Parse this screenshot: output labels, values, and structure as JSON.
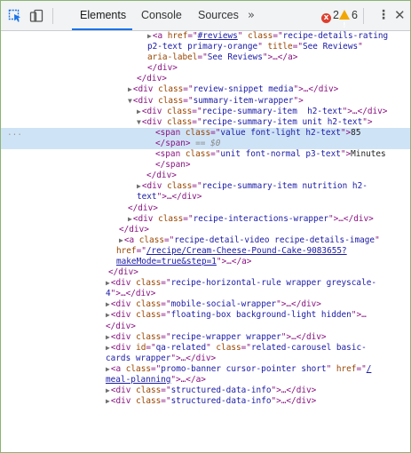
{
  "toolbar": {
    "tabs": [
      "Elements",
      "Console",
      "Sources"
    ],
    "more_tabs": "»",
    "error_count": "2",
    "warning_count": "6",
    "error_glyph": "x",
    "kebab": "⋮",
    "close": "✕"
  },
  "colors": {
    "tag": "#881280",
    "attr_name": "#994500",
    "attr_value": "#1a1aa6",
    "selection": "#cfe3f6",
    "accent": "#1a73e8"
  },
  "lines": [
    [
      [
        "tri",
        "▶"
      ],
      [
        "tag",
        "<a "
      ],
      [
        "attr",
        "href"
      ],
      [
        "tag",
        "=\""
      ],
      [
        "link",
        "#reviews"
      ],
      [
        "tag",
        "\" "
      ],
      [
        "attr",
        "class"
      ],
      [
        "tag",
        "=\""
      ],
      [
        "val",
        "recipe-details-rating"
      ]
    ],
    [
      [
        "val",
        "p2-text primary-orange"
      ],
      [
        "tag",
        "\" "
      ],
      [
        "attr",
        "title"
      ],
      [
        "tag",
        "=\""
      ],
      [
        "val",
        "See Reviews"
      ],
      [
        "tag",
        "\""
      ]
    ],
    [
      [
        "attr",
        "aria-label"
      ],
      [
        "tag",
        "=\""
      ],
      [
        "val",
        "See Reviews"
      ],
      [
        "tag",
        "\">…</a>"
      ]
    ],
    [
      [
        "tag",
        "</div>"
      ]
    ],
    [
      [
        "tag",
        "</div>"
      ]
    ],
    [
      [
        "tri",
        "▶"
      ],
      [
        "tag",
        "<div "
      ],
      [
        "attr",
        "class"
      ],
      [
        "tag",
        "=\""
      ],
      [
        "val",
        "review-snippet media"
      ],
      [
        "tag",
        "\">…</div>"
      ]
    ],
    [
      [
        "tri",
        "▼"
      ],
      [
        "tag",
        "<div "
      ],
      [
        "attr",
        "class"
      ],
      [
        "tag",
        "=\""
      ],
      [
        "val",
        "summary-item-wrapper"
      ],
      [
        "tag",
        "\">"
      ]
    ],
    [
      [
        "tri",
        "▶"
      ],
      [
        "tag",
        "<div "
      ],
      [
        "attr",
        "class"
      ],
      [
        "tag",
        "=\""
      ],
      [
        "val",
        "recipe-summary-item  h2-text"
      ],
      [
        "tag",
        "\">…</div>"
      ]
    ],
    [
      [
        "tri",
        "▼"
      ],
      [
        "tag",
        "<div "
      ],
      [
        "attr",
        "class"
      ],
      [
        "tag",
        "=\""
      ],
      [
        "val",
        "recipe-summary-item unit h2-text"
      ],
      [
        "tag",
        "\">"
      ]
    ],
    [
      [
        "tag",
        "<span "
      ],
      [
        "attr",
        "class"
      ],
      [
        "tag",
        "=\""
      ],
      [
        "val",
        "value font-light h2-text"
      ],
      [
        "tag",
        "\">"
      ],
      [
        "txt",
        "85"
      ]
    ],
    [
      [
        "tag",
        "</span>"
      ],
      [
        "pseudo",
        " == "
      ],
      [
        "dollar",
        "$0"
      ]
    ],
    [
      [
        "tag",
        "<span "
      ],
      [
        "attr",
        "class"
      ],
      [
        "tag",
        "=\""
      ],
      [
        "val",
        "unit font-normal p3-text"
      ],
      [
        "tag",
        "\">"
      ],
      [
        "txt",
        "Minutes"
      ]
    ],
    [
      [
        "tag",
        "</span>"
      ]
    ],
    [
      [
        "tag",
        "</div>"
      ]
    ],
    [
      [
        "tri",
        "▶"
      ],
      [
        "tag",
        "<div "
      ],
      [
        "attr",
        "class"
      ],
      [
        "tag",
        "=\""
      ],
      [
        "val",
        "recipe-summary-item nutrition h2-"
      ]
    ],
    [
      [
        "val",
        "text"
      ],
      [
        "tag",
        "\">…</div>"
      ]
    ],
    [
      [
        "tag",
        "</div>"
      ]
    ],
    [
      [
        "tri",
        "▶"
      ],
      [
        "tag",
        "<div "
      ],
      [
        "attr",
        "class"
      ],
      [
        "tag",
        "=\""
      ],
      [
        "val",
        "recipe-interactions-wrapper"
      ],
      [
        "tag",
        "\">…</div>"
      ]
    ],
    [
      [
        "tag",
        "</div>"
      ]
    ],
    [
      [
        "tri",
        "▶"
      ],
      [
        "tag",
        "<a "
      ],
      [
        "attr",
        "class"
      ],
      [
        "tag",
        "=\""
      ],
      [
        "val",
        "recipe-detail-video recipe-details-image"
      ],
      [
        "tag",
        "\""
      ]
    ],
    [
      [
        "attr",
        "href"
      ],
      [
        "tag",
        "=\""
      ],
      [
        "link",
        "/recipe/Cream-Cheese-Pound-Cake-9083655?"
      ]
    ],
    [
      [
        "link",
        "makeMode=true&step=1"
      ],
      [
        "tag",
        "\">…</a>"
      ]
    ],
    [
      [
        "tag",
        "</div>"
      ]
    ],
    [
      [
        "tri",
        "▶"
      ],
      [
        "tag",
        "<div "
      ],
      [
        "attr",
        "class"
      ],
      [
        "tag",
        "=\""
      ],
      [
        "val",
        "recipe-horizontal-rule wrapper greyscale-"
      ]
    ],
    [
      [
        "val",
        "4"
      ],
      [
        "tag",
        "\">…</div>"
      ]
    ],
    [
      [
        "tri",
        "▶"
      ],
      [
        "tag",
        "<div "
      ],
      [
        "attr",
        "class"
      ],
      [
        "tag",
        "=\""
      ],
      [
        "val",
        "mobile-social-wrapper"
      ],
      [
        "tag",
        "\">…</div>"
      ]
    ],
    [
      [
        "tri",
        "▶"
      ],
      [
        "tag",
        "<div "
      ],
      [
        "attr",
        "class"
      ],
      [
        "tag",
        "=\""
      ],
      [
        "val",
        "floating-box background-light hidden"
      ],
      [
        "tag",
        "\">…"
      ]
    ],
    [
      [
        "tag",
        "</div>"
      ]
    ],
    [
      [
        "tri",
        "▶"
      ],
      [
        "tag",
        "<div "
      ],
      [
        "attr",
        "class"
      ],
      [
        "tag",
        "=\""
      ],
      [
        "val",
        "recipe-wrapper wrapper"
      ],
      [
        "tag",
        "\">…</div>"
      ]
    ],
    [
      [
        "tri",
        "▶"
      ],
      [
        "tag",
        "<div "
      ],
      [
        "attr",
        "id"
      ],
      [
        "tag",
        "=\""
      ],
      [
        "val",
        "qa-related"
      ],
      [
        "tag",
        "\" "
      ],
      [
        "attr",
        "class"
      ],
      [
        "tag",
        "=\""
      ],
      [
        "val",
        "related-carousel basic-"
      ]
    ],
    [
      [
        "val",
        "cards wrapper"
      ],
      [
        "tag",
        "\">…</div>"
      ]
    ],
    [
      [
        "tri",
        "▶"
      ],
      [
        "tag",
        "<a "
      ],
      [
        "attr",
        "class"
      ],
      [
        "tag",
        "=\""
      ],
      [
        "val",
        "promo-banner cursor-pointer short"
      ],
      [
        "tag",
        "\" "
      ],
      [
        "attr",
        "href"
      ],
      [
        "tag",
        "=\""
      ],
      [
        "link",
        "/"
      ]
    ],
    [
      [
        "link",
        "meal-planning"
      ],
      [
        "tag",
        "\">…</a>"
      ]
    ],
    [
      [
        "tri",
        "▶"
      ],
      [
        "tag",
        "<div "
      ],
      [
        "attr",
        "class"
      ],
      [
        "tag",
        "=\""
      ],
      [
        "val",
        "structured-data-info"
      ],
      [
        "tag",
        "\">…</div>"
      ]
    ],
    [
      [
        "tri",
        "▶"
      ],
      [
        "tag",
        "<div "
      ],
      [
        "attr",
        "class"
      ],
      [
        "tag",
        "=\""
      ],
      [
        "val",
        "structured-data-info"
      ],
      [
        "tag",
        "\">…</div>"
      ]
    ]
  ],
  "selected_line_marker": "..."
}
